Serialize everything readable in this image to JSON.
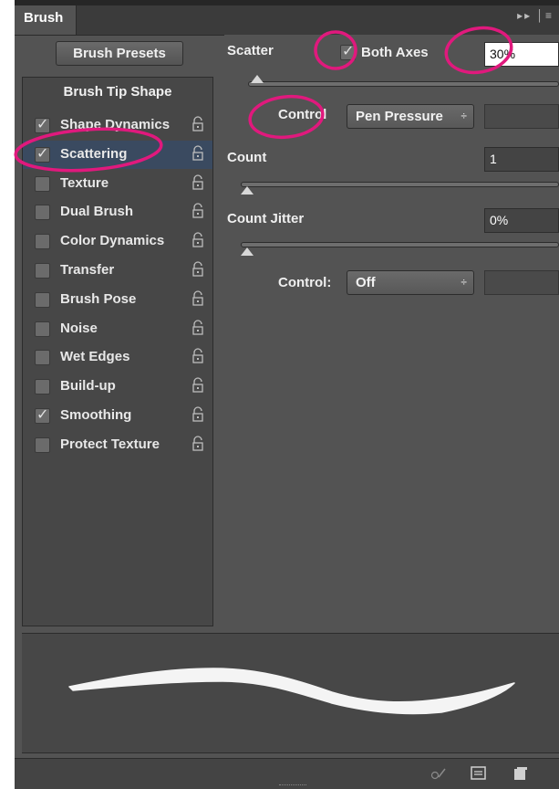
{
  "panel": {
    "tab_title": "Brush",
    "presets_button": "Brush Presets",
    "tip_shape_header": "Brush Tip Shape"
  },
  "options": [
    {
      "label": "Shape Dynamics",
      "checked": true,
      "selected": false
    },
    {
      "label": "Scattering",
      "checked": true,
      "selected": true
    },
    {
      "label": "Texture",
      "checked": false,
      "selected": false
    },
    {
      "label": "Dual Brush",
      "checked": false,
      "selected": false
    },
    {
      "label": "Color Dynamics",
      "checked": false,
      "selected": false
    },
    {
      "label": "Transfer",
      "checked": false,
      "selected": false
    },
    {
      "label": "Brush Pose",
      "checked": false,
      "selected": false
    },
    {
      "label": "Noise",
      "checked": false,
      "selected": false
    },
    {
      "label": "Wet Edges",
      "checked": false,
      "selected": false
    },
    {
      "label": "Build-up",
      "checked": false,
      "selected": false
    },
    {
      "label": "Smoothing",
      "checked": true,
      "selected": false
    },
    {
      "label": "Protect Texture",
      "checked": false,
      "selected": false
    }
  ],
  "settings": {
    "scatter_label": "Scatter",
    "both_axes_label": "Both Axes",
    "both_axes_checked": true,
    "scatter_value": "30%",
    "scatter_slider": 0.03,
    "control1_label": "Control",
    "control1_value": "Pen Pressure",
    "count_label": "Count",
    "count_value": "1",
    "count_slider": 0.0,
    "count_jitter_label": "Count Jitter",
    "count_jitter_value": "0%",
    "count_jitter_slider": 0.0,
    "control2_label": "Control:",
    "control2_value": "Off"
  },
  "icons": {
    "title_bar": [
      "expand-icon",
      "panel-menu-icon"
    ],
    "bottom_bar": [
      "toggle-preview-icon",
      "brush-preset-icon",
      "new-brush-icon"
    ]
  },
  "colors": {
    "panel_bg": "#535353",
    "selected_row": "#3a4a60",
    "annotation": "#e0197d"
  }
}
